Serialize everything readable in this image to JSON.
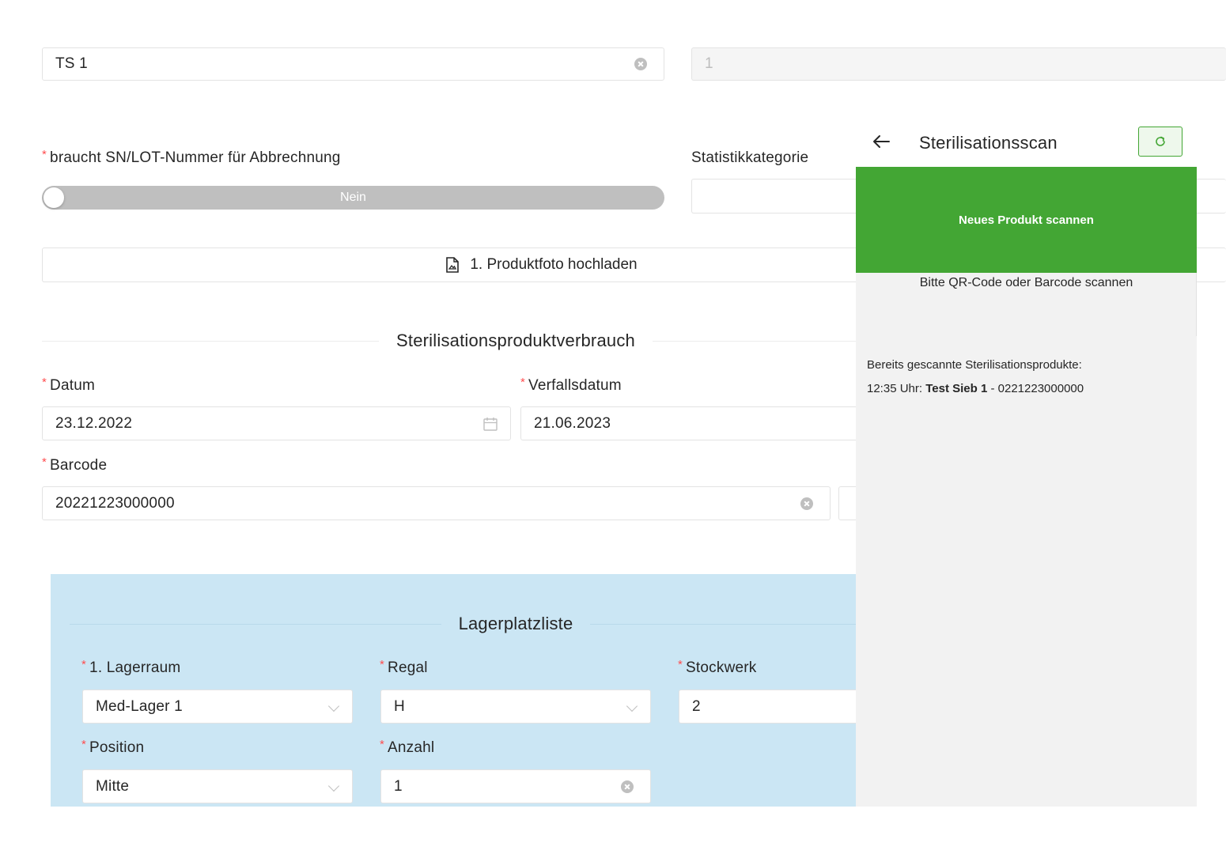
{
  "top": {
    "ts_value": "TS 1",
    "count_value": "1"
  },
  "sn_lot": {
    "label": "braucht SN/LOT-Nummer für Abbrechnung",
    "toggle_text": "Nein"
  },
  "statistik": {
    "label": "Statistikkategorie"
  },
  "upload": {
    "label": "1. Produktfoto hochladen"
  },
  "consumption": {
    "title": "Sterilisationsproduktverbrauch",
    "datum_label": "Datum",
    "datum_value": "23.12.2022",
    "verfall_label": "Verfallsdatum",
    "verfall_value": "21.06.2023",
    "barcode_label": "Barcode",
    "barcode_value": "20221223000000"
  },
  "storage": {
    "title": "Lagerplatzliste",
    "lagerraum_label": "1. Lagerraum",
    "lagerraum_value": "Med-Lager 1",
    "regal_label": "Regal",
    "regal_value": "H",
    "stockwerk_label": "Stockwerk",
    "stockwerk_value": "2",
    "position_label": "Position",
    "position_value": "Mitte",
    "anzahl_label": "Anzahl",
    "anzahl_value": "1"
  },
  "scan_panel": {
    "title": "Sterilisationsscan",
    "scan_button": "Neues Produkt scannen",
    "hint": "Bitte QR-Code oder Barcode scannen",
    "history_label": "Bereits gescannte Sterilisationsprodukte:",
    "history": [
      {
        "time": "12:35 Uhr:",
        "name": "Test Sieb 1",
        "code": "- 0221223000000"
      }
    ],
    "accent": "#43a634"
  }
}
